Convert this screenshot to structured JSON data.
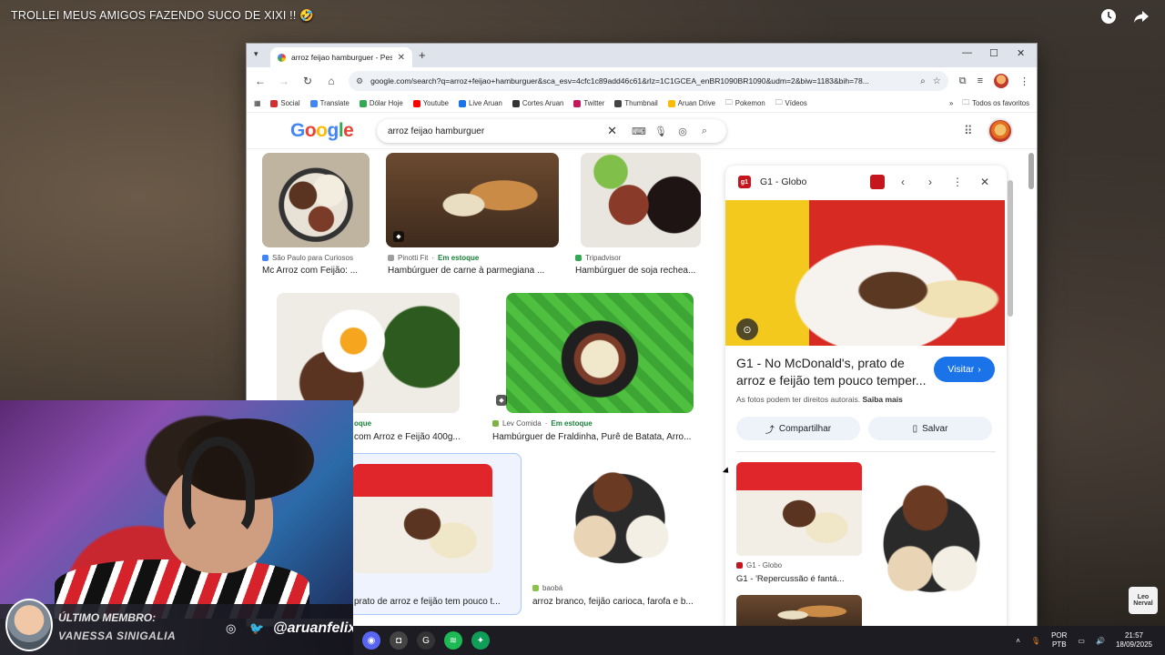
{
  "video": {
    "title": "TROLLEI MEUS AMIGOS FAZENDO SUCO DE XIXI !! 🤣",
    "icons": [
      "clock-icon",
      "share-icon"
    ]
  },
  "browser": {
    "tab_title": "arroz feijao hamburguer - Pesq",
    "url": "google.com/search?q=arroz+feijao+hamburguer&sca_esv=4cfc1c89add46c61&rlz=1C1GCEA_enBR1090BR1090&udm=2&biw=1183&bih=78...",
    "bookmarks": [
      "Social",
      "Translate",
      "Dólar Hoje",
      "Youtube",
      "Live Aruan",
      "Cortes Aruan",
      "Twitter",
      "Thumbnail",
      "Aruan Drive",
      "Pokemon",
      "Vídeos"
    ],
    "bookmarks_right": "Todos os favoritos"
  },
  "google": {
    "logo": "Google",
    "query": "arroz feijao hamburguer"
  },
  "results": [
    {
      "source": "São Paulo para Curiosos",
      "title": "Mc Arroz com Feijão: ...",
      "in_stock": ""
    },
    {
      "source": "Pinotti Fit",
      "title": "Hambúrguer de carne à parmegiana ...",
      "in_stock": "Em estoque"
    },
    {
      "source": "Tripadvisor",
      "title": "Hambúrguer de soja recheа...",
      "in_stock": ""
    },
    {
      "source": "",
      "title": "com Arroz e Feijão 400g...",
      "in_stock": "oque"
    },
    {
      "source": "Lev Comida",
      "title": "Hambúrguer de Fraldinha, Purê de Batata, Arro...",
      "in_stock": "Em estoque"
    },
    {
      "source": "",
      "title": "prato de arroz e feijão tem pouco t...",
      "in_stock": ""
    },
    {
      "source": "baobá",
      "title": "arroz branco, feijão carioca, farofa e b...",
      "in_stock": ""
    }
  ],
  "panel": {
    "source": "G1 - Globo",
    "title": "G1 - No McDonald's, prato de arroz e feijão tem pouco temper...",
    "visit_label": "Visitar",
    "copyright": "As fotos podem ter direitos autorais.",
    "learn_more": "Saiba mais",
    "share_label": "Compartilhar",
    "save_label": "Salvar",
    "related": [
      {
        "source": "G1 - Globo",
        "title": "G1 - 'Repercussão é fantá..."
      }
    ]
  },
  "stream": {
    "member_label": "ÚLTIMO MEMBRO:",
    "member_name": "VANESSA SINIGALIA",
    "handle": "@aruanfelix"
  },
  "taskbar": {
    "lang_top": "POR",
    "lang_bottom": "PTB",
    "time": "21:57",
    "date": "18/09/2025"
  },
  "watermark": "Leo Nerval"
}
